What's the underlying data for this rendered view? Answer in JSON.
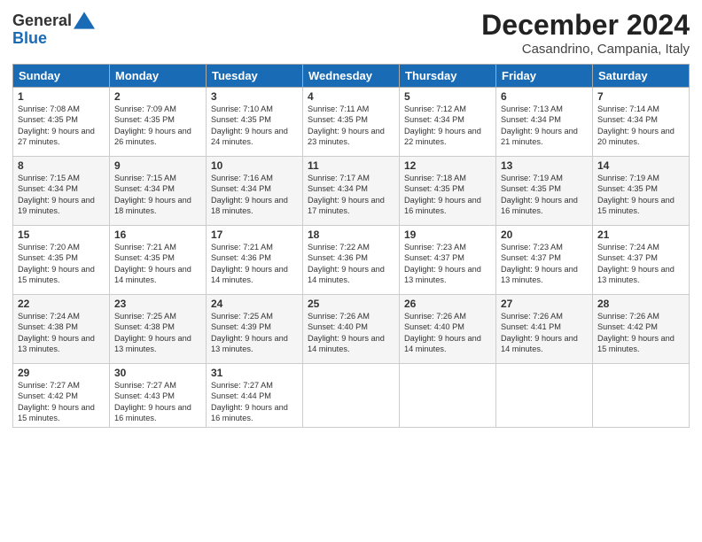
{
  "logo": {
    "line1": "General",
    "line2": "Blue"
  },
  "title": "December 2024",
  "subtitle": "Casandrino, Campania, Italy",
  "headers": [
    "Sunday",
    "Monday",
    "Tuesday",
    "Wednesday",
    "Thursday",
    "Friday",
    "Saturday"
  ],
  "weeks": [
    [
      {
        "day": "1",
        "sunrise": "7:08 AM",
        "sunset": "4:35 PM",
        "daylight": "9 hours and 27 minutes."
      },
      {
        "day": "2",
        "sunrise": "7:09 AM",
        "sunset": "4:35 PM",
        "daylight": "9 hours and 26 minutes."
      },
      {
        "day": "3",
        "sunrise": "7:10 AM",
        "sunset": "4:35 PM",
        "daylight": "9 hours and 24 minutes."
      },
      {
        "day": "4",
        "sunrise": "7:11 AM",
        "sunset": "4:35 PM",
        "daylight": "9 hours and 23 minutes."
      },
      {
        "day": "5",
        "sunrise": "7:12 AM",
        "sunset": "4:34 PM",
        "daylight": "9 hours and 22 minutes."
      },
      {
        "day": "6",
        "sunrise": "7:13 AM",
        "sunset": "4:34 PM",
        "daylight": "9 hours and 21 minutes."
      },
      {
        "day": "7",
        "sunrise": "7:14 AM",
        "sunset": "4:34 PM",
        "daylight": "9 hours and 20 minutes."
      }
    ],
    [
      {
        "day": "8",
        "sunrise": "7:15 AM",
        "sunset": "4:34 PM",
        "daylight": "9 hours and 19 minutes."
      },
      {
        "day": "9",
        "sunrise": "7:15 AM",
        "sunset": "4:34 PM",
        "daylight": "9 hours and 18 minutes."
      },
      {
        "day": "10",
        "sunrise": "7:16 AM",
        "sunset": "4:34 PM",
        "daylight": "9 hours and 18 minutes."
      },
      {
        "day": "11",
        "sunrise": "7:17 AM",
        "sunset": "4:34 PM",
        "daylight": "9 hours and 17 minutes."
      },
      {
        "day": "12",
        "sunrise": "7:18 AM",
        "sunset": "4:35 PM",
        "daylight": "9 hours and 16 minutes."
      },
      {
        "day": "13",
        "sunrise": "7:19 AM",
        "sunset": "4:35 PM",
        "daylight": "9 hours and 16 minutes."
      },
      {
        "day": "14",
        "sunrise": "7:19 AM",
        "sunset": "4:35 PM",
        "daylight": "9 hours and 15 minutes."
      }
    ],
    [
      {
        "day": "15",
        "sunrise": "7:20 AM",
        "sunset": "4:35 PM",
        "daylight": "9 hours and 15 minutes."
      },
      {
        "day": "16",
        "sunrise": "7:21 AM",
        "sunset": "4:35 PM",
        "daylight": "9 hours and 14 minutes."
      },
      {
        "day": "17",
        "sunrise": "7:21 AM",
        "sunset": "4:36 PM",
        "daylight": "9 hours and 14 minutes."
      },
      {
        "day": "18",
        "sunrise": "7:22 AM",
        "sunset": "4:36 PM",
        "daylight": "9 hours and 14 minutes."
      },
      {
        "day": "19",
        "sunrise": "7:23 AM",
        "sunset": "4:37 PM",
        "daylight": "9 hours and 13 minutes."
      },
      {
        "day": "20",
        "sunrise": "7:23 AM",
        "sunset": "4:37 PM",
        "daylight": "9 hours and 13 minutes."
      },
      {
        "day": "21",
        "sunrise": "7:24 AM",
        "sunset": "4:37 PM",
        "daylight": "9 hours and 13 minutes."
      }
    ],
    [
      {
        "day": "22",
        "sunrise": "7:24 AM",
        "sunset": "4:38 PM",
        "daylight": "9 hours and 13 minutes."
      },
      {
        "day": "23",
        "sunrise": "7:25 AM",
        "sunset": "4:38 PM",
        "daylight": "9 hours and 13 minutes."
      },
      {
        "day": "24",
        "sunrise": "7:25 AM",
        "sunset": "4:39 PM",
        "daylight": "9 hours and 13 minutes."
      },
      {
        "day": "25",
        "sunrise": "7:26 AM",
        "sunset": "4:40 PM",
        "daylight": "9 hours and 14 minutes."
      },
      {
        "day": "26",
        "sunrise": "7:26 AM",
        "sunset": "4:40 PM",
        "daylight": "9 hours and 14 minutes."
      },
      {
        "day": "27",
        "sunrise": "7:26 AM",
        "sunset": "4:41 PM",
        "daylight": "9 hours and 14 minutes."
      },
      {
        "day": "28",
        "sunrise": "7:26 AM",
        "sunset": "4:42 PM",
        "daylight": "9 hours and 15 minutes."
      }
    ],
    [
      {
        "day": "29",
        "sunrise": "7:27 AM",
        "sunset": "4:42 PM",
        "daylight": "9 hours and 15 minutes."
      },
      {
        "day": "30",
        "sunrise": "7:27 AM",
        "sunset": "4:43 PM",
        "daylight": "9 hours and 16 minutes."
      },
      {
        "day": "31",
        "sunrise": "7:27 AM",
        "sunset": "4:44 PM",
        "daylight": "9 hours and 16 minutes."
      },
      null,
      null,
      null,
      null
    ]
  ]
}
